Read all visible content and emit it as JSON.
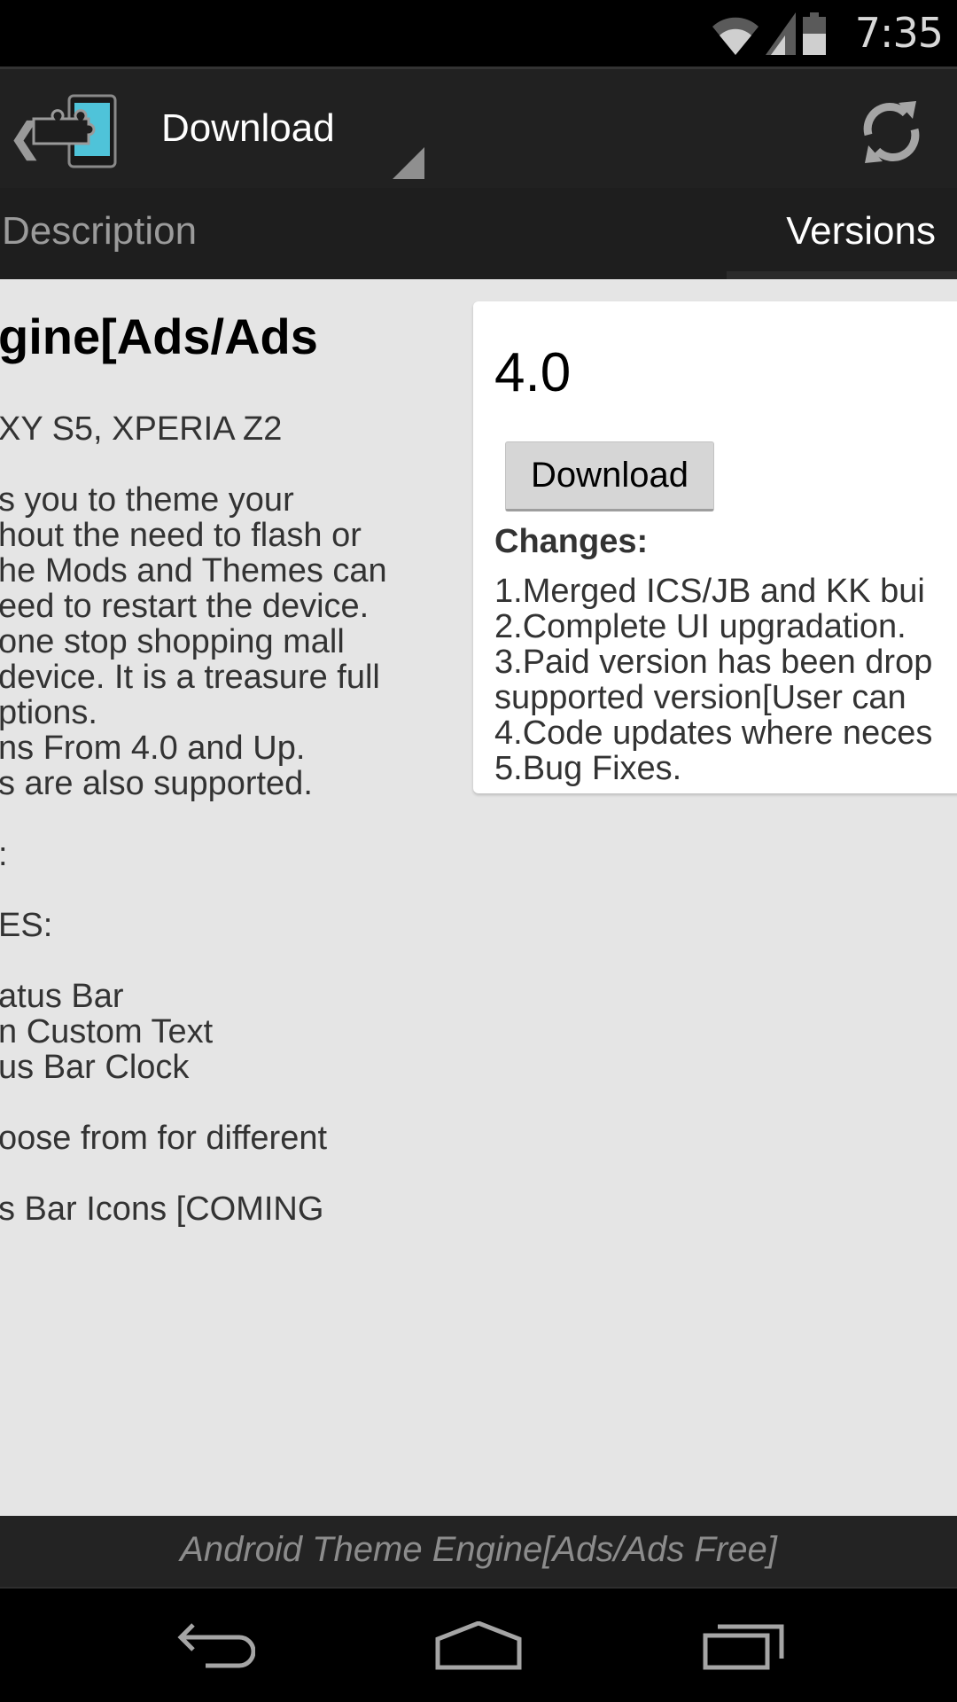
{
  "status_bar": {
    "time": "7:35",
    "icons": [
      "wifi-icon",
      "signal-icon",
      "battery-icon"
    ]
  },
  "action_bar": {
    "up_icon": "chevron-left-icon",
    "app_icon": "xposed-puzzle-phone-icon",
    "title": "Download",
    "spinner_icon": "dropdown-triangle-icon",
    "refresh_icon": "refresh-icon"
  },
  "tabs": [
    {
      "label": "Description",
      "selected": false
    },
    {
      "label": "Versions",
      "selected": true
    }
  ],
  "description": {
    "title": "gine[Ads/Ads",
    "lines": [
      "XY S5, XPERIA Z2",
      "s you to theme your",
      "hout the need to flash or",
      "he Mods and Themes can",
      "eed to restart the device.",
      "one stop shopping mall",
      "device. It is a treasure full",
      "ptions.",
      "ns From 4.0 and Up.",
      "s are also supported.",
      ":",
      "ES:",
      "atus Bar",
      "n Custom Text",
      "us Bar Clock",
      "oose from for different",
      "s Bar Icons [COMING"
    ]
  },
  "version_card": {
    "version": "4.0",
    "download_label": "Download",
    "changes_label": "Changes:",
    "changes": [
      "1.Merged ICS/JB and KK bui",
      "2.Complete UI upgradation.",
      "3.Paid version has been drop",
      "supported version[User can",
      "4.Code updates where neces",
      "5.Bug Fixes."
    ]
  },
  "footer": {
    "text": "Android Theme Engine[Ads/Ads Free]"
  },
  "nav_bar": {
    "back": "back-icon",
    "home": "home-icon",
    "recents": "recents-icon"
  },
  "colors": {
    "accent": "#4fc3d9",
    "action_bar": "#212121",
    "background": "#e5e5e5"
  }
}
